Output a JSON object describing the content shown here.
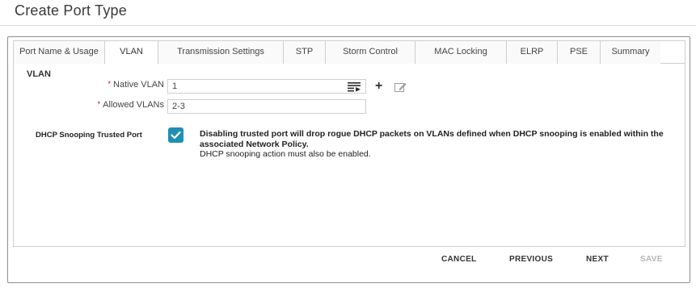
{
  "window": {
    "title": "Create Port Type"
  },
  "tabs": [
    {
      "label": "Port Name & Usage",
      "active": false
    },
    {
      "label": "VLAN",
      "active": true
    },
    {
      "label": "Transmission Settings",
      "active": false
    },
    {
      "label": "STP",
      "active": false
    },
    {
      "label": "Storm Control",
      "active": false
    },
    {
      "label": "MAC Locking",
      "active": false
    },
    {
      "label": "ELRP",
      "active": false
    },
    {
      "label": "PSE",
      "active": false
    },
    {
      "label": "Summary",
      "active": false
    }
  ],
  "vlan": {
    "section_title": "VLAN",
    "native_vlan": {
      "required_mark": "*",
      "label": "Native VLAN",
      "value": "1"
    },
    "allowed_vlans": {
      "required_mark": "*",
      "label": "Allowed VLANs",
      "value": "2-3"
    }
  },
  "dhcp": {
    "label": "DHCP Snooping Trusted Port",
    "checked": true,
    "note_line1": "Disabling trusted port will drop rogue DHCP packets on VLANs defined when DHCP snooping is enabled within the associated Network Policy.",
    "note_line2": "DHCP snooping action must also be enabled."
  },
  "footer": {
    "cancel": "CANCEL",
    "previous": "PREVIOUS",
    "next": "NEXT",
    "save": "SAVE"
  },
  "colors": {
    "accent": "#1f8fb4",
    "required": "#d0021b",
    "disabled_text": "#b6b6b6"
  },
  "icons": [
    "list-icon",
    "plus-icon",
    "edit-icon",
    "check-icon"
  ]
}
